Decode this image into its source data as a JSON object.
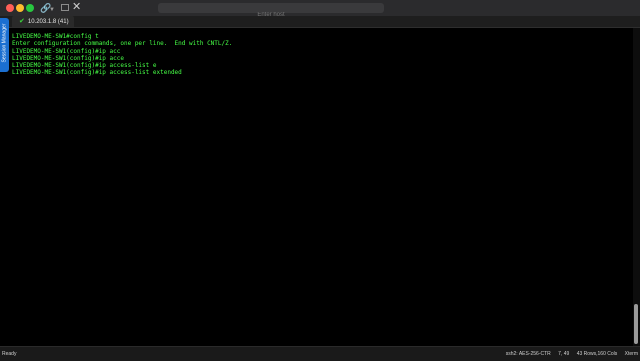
{
  "titlebar": {
    "command_placeholder": "Enter host"
  },
  "tab": {
    "label": "10.203.1.8 (41)"
  },
  "sidebar": {
    "label": "Session Manager"
  },
  "terminal": {
    "lines": [
      "LIVEDEMO-ME-SW1#config t",
      "Enter configuration commands, one per line.  End with CNTL/Z.",
      "LIVEDEMO-ME-SW1(config)#ip acc",
      "LIVEDEMO-ME-SW1(config)#ip acce",
      "LIVEDEMO-ME-SW1(config)#ip access-list e",
      "LIVEDEMO-ME-SW1(config)#ip access-list extended"
    ]
  },
  "statusbar": {
    "ready": "Ready",
    "cipher": "ssh2: AES-256-CTR",
    "cursor": "7, 49",
    "size": "43 Rows,160 Cols",
    "term": "Xterm"
  },
  "colors": {
    "terminal_text": "#46ff46",
    "sidebar": "#1b6fd1"
  }
}
